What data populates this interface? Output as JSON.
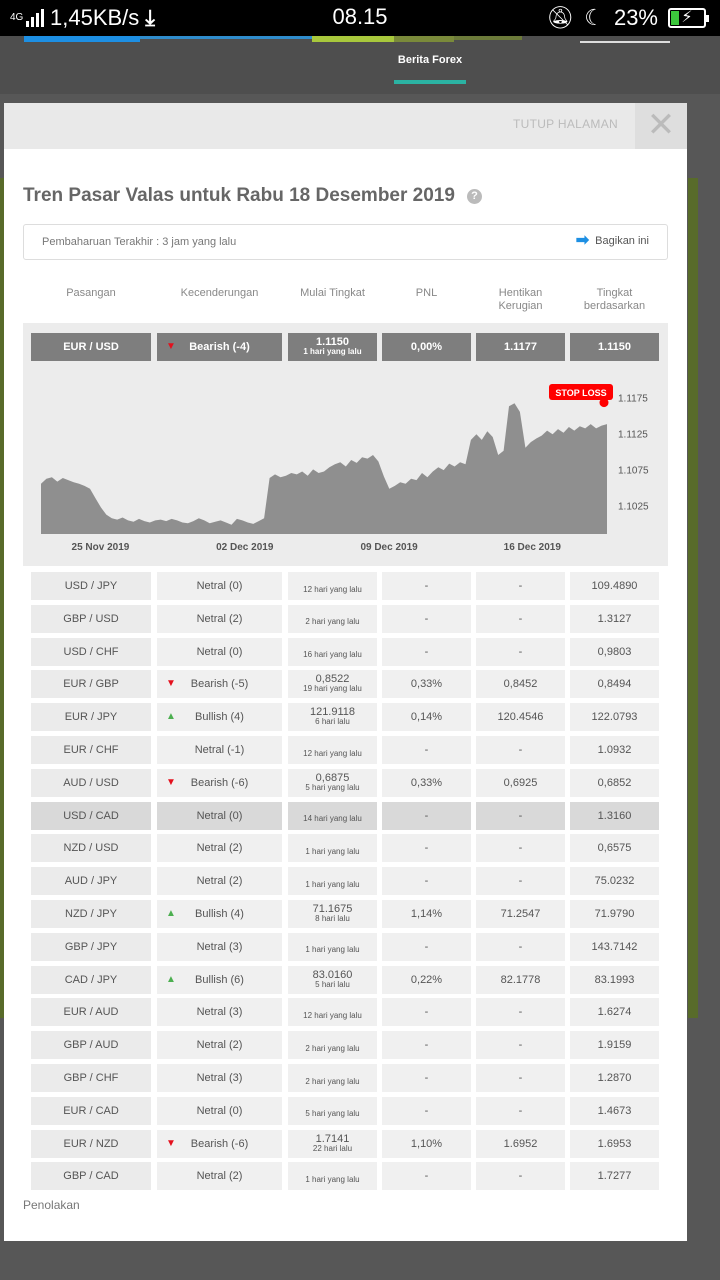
{
  "status_bar": {
    "network": "4G",
    "speed": "1,45KB/s",
    "time": "08.15",
    "battery": "23%"
  },
  "background": {
    "tab_label": "Berita Forex"
  },
  "modal": {
    "close_label": "TUTUP HALAMAN",
    "title": "Tren Pasar Valas untuk Rabu 18 Desember 2019",
    "update_text": "Pembaharuan Terakhir : 3 jam yang lalu",
    "share_label": "Bagikan ini",
    "disclaimer": "Penolakan"
  },
  "columns": {
    "pair": "Pasangan",
    "trend": "Kecenderungan",
    "start": "Mulai Tingkat",
    "pnl": "PNL",
    "stop_loss_l1": "Hentikan",
    "stop_loss_l2": "Kerugian",
    "rate_l1": "Tingkat",
    "rate_l2": "berdasarkan"
  },
  "featured": {
    "pair": "EUR / USD",
    "trend": "Bearish (-4)",
    "trend_dir": "down",
    "start_value": "1.1150",
    "start_time": "1 hari yang lalu",
    "pnl": "0,00%",
    "stop_loss": "1.1177",
    "rate": "1.1150"
  },
  "chart_data": {
    "type": "area",
    "x_tick_labels": [
      "25 Nov 2019",
      "02 Dec 2019",
      "09 Dec 2019",
      "16 Dec 2019"
    ],
    "y_tick_labels": [
      "1.1175",
      "1.1125",
      "1.1075",
      "1.1025"
    ],
    "annotation": "STOP LOSS",
    "stop_loss_level": 1.1168,
    "ylim": [
      1.0985,
      1.1205
    ],
    "series": [
      {
        "values": [
          1.1055,
          1.1062,
          1.1064,
          1.1058,
          1.1063,
          1.106,
          1.1057,
          1.1055,
          1.1052,
          1.1048,
          1.1035,
          1.1022,
          1.1012,
          1.1007,
          1.1005,
          1.1008,
          1.1004,
          1.1002,
          1.1006,
          1.1003,
          1.1001,
          1.1004,
          1.1005,
          1.1003,
          1.1006,
          1.1004,
          1.1001,
          1.1,
          1.1003,
          1.1007,
          1.1004,
          1.1,
          1.1002,
          1.1004,
          1.1001,
          1.0998,
          1.1006,
          1.1004,
          1.1001,
          1.0999,
          1.1003,
          1.1007,
          1.1063,
          1.1068,
          1.1064,
          1.1066,
          1.107,
          1.1068,
          1.1072,
          1.1066,
          1.1075,
          1.107,
          1.1072,
          1.1078,
          1.1082,
          1.1085,
          1.1079,
          1.1088,
          1.1084,
          1.1092,
          1.109,
          1.1095,
          1.1086,
          1.1065,
          1.1048,
          1.1052,
          1.1057,
          1.1055,
          1.1062,
          1.106,
          1.107,
          1.1064,
          1.1072,
          1.1078,
          1.1074,
          1.1083,
          1.1079,
          1.1085,
          1.1082,
          1.1116,
          1.1124,
          1.1116,
          1.1128,
          1.112,
          1.1095,
          1.1101,
          1.1163,
          1.1167,
          1.1155,
          1.1105,
          1.1113,
          1.1118,
          1.1122,
          1.1129,
          1.1124,
          1.1131,
          1.1126,
          1.1134,
          1.1129,
          1.1135,
          1.1132,
          1.1138,
          1.1132,
          1.1136,
          1.1138
        ]
      }
    ]
  },
  "rows": [
    {
      "pair": "USD / JPY",
      "trend": "Netral (0)",
      "trend_dir": "none",
      "start_value": "",
      "start_time": "12 hari yang lalu",
      "pnl": "-",
      "stop_loss": "-",
      "rate": "109.4890",
      "hl": false
    },
    {
      "pair": "GBP / USD",
      "trend": "Netral (2)",
      "trend_dir": "none",
      "start_value": "",
      "start_time": "2 hari yang lalu",
      "pnl": "-",
      "stop_loss": "-",
      "rate": "1.3127",
      "hl": false
    },
    {
      "pair": "USD / CHF",
      "trend": "Netral (0)",
      "trend_dir": "none",
      "start_value": "",
      "start_time": "16 hari yang lalu",
      "pnl": "-",
      "stop_loss": "-",
      "rate": "0,9803",
      "hl": false
    },
    {
      "pair": "EUR / GBP",
      "trend": "Bearish (-5)",
      "trend_dir": "down",
      "start_value": "0,8522",
      "start_time": "19 hari yang lalu",
      "pnl": "0,33%",
      "stop_loss": "0,8452",
      "rate": "0,8494",
      "hl": false
    },
    {
      "pair": "EUR / JPY",
      "trend": "Bullish (4)",
      "trend_dir": "up",
      "start_value": "121.9118",
      "start_time": "6 hari lalu",
      "pnl": "0,14%",
      "stop_loss": "120.4546",
      "rate": "122.0793",
      "hl": false
    },
    {
      "pair": "EUR / CHF",
      "trend": "Netral (-1)",
      "trend_dir": "none",
      "start_value": "",
      "start_time": "12 hari yang lalu",
      "pnl": "-",
      "stop_loss": "-",
      "rate": "1.0932",
      "hl": false
    },
    {
      "pair": "AUD / USD",
      "trend": "Bearish (-6)",
      "trend_dir": "down",
      "start_value": "0,6875",
      "start_time": "5 hari yang lalu",
      "pnl": "0,33%",
      "stop_loss": "0,6925",
      "rate": "0,6852",
      "hl": false
    },
    {
      "pair": "USD / CAD",
      "trend": "Netral (0)",
      "trend_dir": "none",
      "start_value": "",
      "start_time": "14 hari yang lalu",
      "pnl": "-",
      "stop_loss": "-",
      "rate": "1.3160",
      "hl": true
    },
    {
      "pair": "NZD / USD",
      "trend": "Netral (2)",
      "trend_dir": "none",
      "start_value": "",
      "start_time": "1 hari yang lalu",
      "pnl": "-",
      "stop_loss": "-",
      "rate": "0,6575",
      "hl": false
    },
    {
      "pair": "AUD / JPY",
      "trend": "Netral (2)",
      "trend_dir": "none",
      "start_value": "",
      "start_time": "1 hari yang lalu",
      "pnl": "-",
      "stop_loss": "-",
      "rate": "75.0232",
      "hl": false
    },
    {
      "pair": "NZD / JPY",
      "trend": "Bullish (4)",
      "trend_dir": "up",
      "start_value": "71.1675",
      "start_time": "8 hari lalu",
      "pnl": "1,14%",
      "stop_loss": "71.2547",
      "rate": "71.9790",
      "hl": false
    },
    {
      "pair": "GBP / JPY",
      "trend": "Netral (3)",
      "trend_dir": "none",
      "start_value": "",
      "start_time": "1 hari yang lalu",
      "pnl": "-",
      "stop_loss": "-",
      "rate": "143.7142",
      "hl": false
    },
    {
      "pair": "CAD / JPY",
      "trend": "Bullish (6)",
      "trend_dir": "up",
      "start_value": "83.0160",
      "start_time": "5 hari lalu",
      "pnl": "0,22%",
      "stop_loss": "82.1778",
      "rate": "83.1993",
      "hl": false
    },
    {
      "pair": "EUR / AUD",
      "trend": "Netral (3)",
      "trend_dir": "none",
      "start_value": "",
      "start_time": "12 hari yang lalu",
      "pnl": "-",
      "stop_loss": "-",
      "rate": "1.6274",
      "hl": false
    },
    {
      "pair": "GBP / AUD",
      "trend": "Netral (2)",
      "trend_dir": "none",
      "start_value": "",
      "start_time": "2 hari yang lalu",
      "pnl": "-",
      "stop_loss": "-",
      "rate": "1.9159",
      "hl": false
    },
    {
      "pair": "GBP / CHF",
      "trend": "Netral (3)",
      "trend_dir": "none",
      "start_value": "",
      "start_time": "2 hari yang lalu",
      "pnl": "-",
      "stop_loss": "-",
      "rate": "1.2870",
      "hl": false
    },
    {
      "pair": "EUR / CAD",
      "trend": "Netral (0)",
      "trend_dir": "none",
      "start_value": "",
      "start_time": "5 hari yang lalu",
      "pnl": "-",
      "stop_loss": "-",
      "rate": "1.4673",
      "hl": false
    },
    {
      "pair": "EUR / NZD",
      "trend": "Bearish (-6)",
      "trend_dir": "down",
      "start_value": "1.7141",
      "start_time": "22 hari lalu",
      "pnl": "1,10%",
      "stop_loss": "1.6952",
      "rate": "1.6953",
      "hl": false
    },
    {
      "pair": "GBP / CAD",
      "trend": "Netral (2)",
      "trend_dir": "none",
      "start_value": "",
      "start_time": "1 hari yang lalu",
      "pnl": "-",
      "stop_loss": "-",
      "rate": "1.7277",
      "hl": false
    }
  ],
  "colors": {
    "accent": "#2bb3a3",
    "share_arrow": "#1d8fe3",
    "bearish": "#e4101d",
    "bullish": "#4caf50",
    "chart_fill": "#8f8f8f",
    "stop_loss": "#ff0000"
  }
}
